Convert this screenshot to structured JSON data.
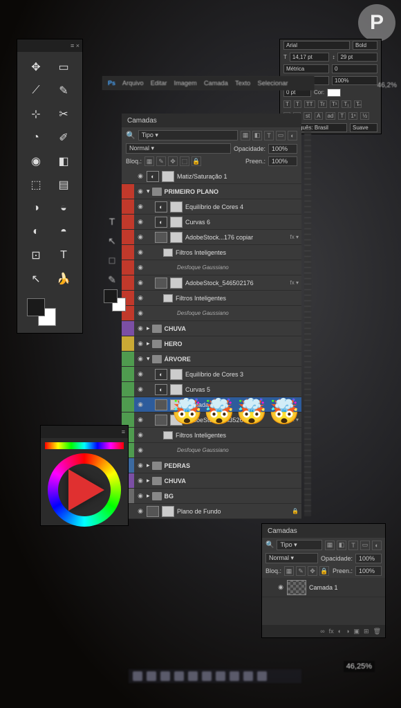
{
  "watermark": "P",
  "menu": [
    "Arquivo",
    "Editar",
    "Imagem",
    "Camada",
    "Texto",
    "Selecionar"
  ],
  "layers_panel": {
    "tab": "Camadas",
    "filter_label": "Tipo",
    "blend_mode": "Normal",
    "opacity_label": "Opacidade:",
    "opacity_value": "100%",
    "fill_label": "Preen.:",
    "fill_value": "100%",
    "lock_label": "Bloq.:"
  },
  "layers": [
    {
      "color": "none",
      "type": "adj",
      "name": "Matiz/Saturação 1",
      "indent": 0
    },
    {
      "color": "red",
      "type": "group",
      "name": "PRIMEIRO PLANO",
      "indent": 0,
      "open": true
    },
    {
      "color": "red",
      "type": "adj",
      "name": "Equilíbrio de Cores 4",
      "indent": 1
    },
    {
      "color": "red",
      "type": "adj",
      "name": "Curvas 6",
      "indent": 1
    },
    {
      "color": "red",
      "type": "smart",
      "name": "AdobeStock...176 copiar",
      "indent": 1,
      "extra": "fx"
    },
    {
      "color": "red",
      "type": "filter",
      "name": "Filtros Inteligentes",
      "indent": 2
    },
    {
      "color": "red",
      "type": "sub",
      "name": "Desfoque Gaussiano",
      "indent": 3
    },
    {
      "color": "red",
      "type": "smart",
      "name": "AdobeStock_546502176",
      "indent": 1,
      "extra": "fx"
    },
    {
      "color": "red",
      "type": "filter",
      "name": "Filtros Inteligentes",
      "indent": 2
    },
    {
      "color": "red",
      "type": "sub",
      "name": "Desfoque Gaussiano",
      "indent": 3
    },
    {
      "color": "violet",
      "type": "group",
      "name": "CHUVA",
      "indent": 0,
      "open": false
    },
    {
      "color": "yellow",
      "type": "group",
      "name": "HERO",
      "indent": 0,
      "open": false
    },
    {
      "color": "green",
      "type": "group",
      "name": "ÁRVORE",
      "indent": 0,
      "open": true
    },
    {
      "color": "green",
      "type": "adj",
      "name": "Equilíbrio de Cores 3",
      "indent": 1
    },
    {
      "color": "green",
      "type": "adj",
      "name": "Curvas 5",
      "indent": 1
    },
    {
      "color": "green",
      "type": "layer",
      "name": "Camada 4",
      "indent": 1,
      "highlight": true
    },
    {
      "color": "green",
      "type": "smart",
      "name": "AdobeStock_543526613",
      "indent": 1,
      "extra": "fx"
    },
    {
      "color": "green",
      "type": "filter",
      "name": "Filtros Inteligentes",
      "indent": 2
    },
    {
      "color": "green",
      "type": "sub",
      "name": "Desfoque Gaussiano",
      "indent": 3
    },
    {
      "color": "blue",
      "type": "group",
      "name": "PEDRAS",
      "indent": 0,
      "open": false
    },
    {
      "color": "violet",
      "type": "group",
      "name": "CHUVA",
      "indent": 0,
      "open": false
    },
    {
      "color": "gray",
      "type": "group",
      "name": "BG",
      "indent": 0,
      "open": false
    },
    {
      "color": "none",
      "type": "layer",
      "name": "Plano de Fundo",
      "indent": 0,
      "locked": true
    }
  ],
  "char_panel": {
    "font": "Arial",
    "style": "Bold",
    "size": "14,17 pt",
    "leading": "29 pt",
    "metrics": "Métrica",
    "tracking": "0",
    "vscale": "100%",
    "hscale": "100%",
    "baseline": "0 pt",
    "color_label": "Cor:",
    "lang": "Português: Brasil",
    "aa": "Suave"
  },
  "tools": [
    "✥",
    "▭",
    "⟋",
    "✎",
    "⊹",
    "✂",
    "◔",
    "✐",
    "◉",
    "◧",
    "⬚",
    "▤",
    "◑",
    "◒",
    "◐",
    "◓",
    "⊡",
    "T",
    "↖",
    "🍌"
  ],
  "mini_layers": {
    "tab": "Camadas",
    "filter_label": "Tipo",
    "blend_mode": "Normal",
    "opacity_label": "Opacidade:",
    "opacity_value": "100%",
    "lock_label": "Bloq.:",
    "fill_label": "Preen.:",
    "fill_value": "100%",
    "layer1": "Camada 1"
  },
  "left_col_tools": [
    "T",
    "↖",
    "□",
    "✎"
  ],
  "emoji": "🤯",
  "zoom": "46,25%",
  "pct_right": "46,2%"
}
